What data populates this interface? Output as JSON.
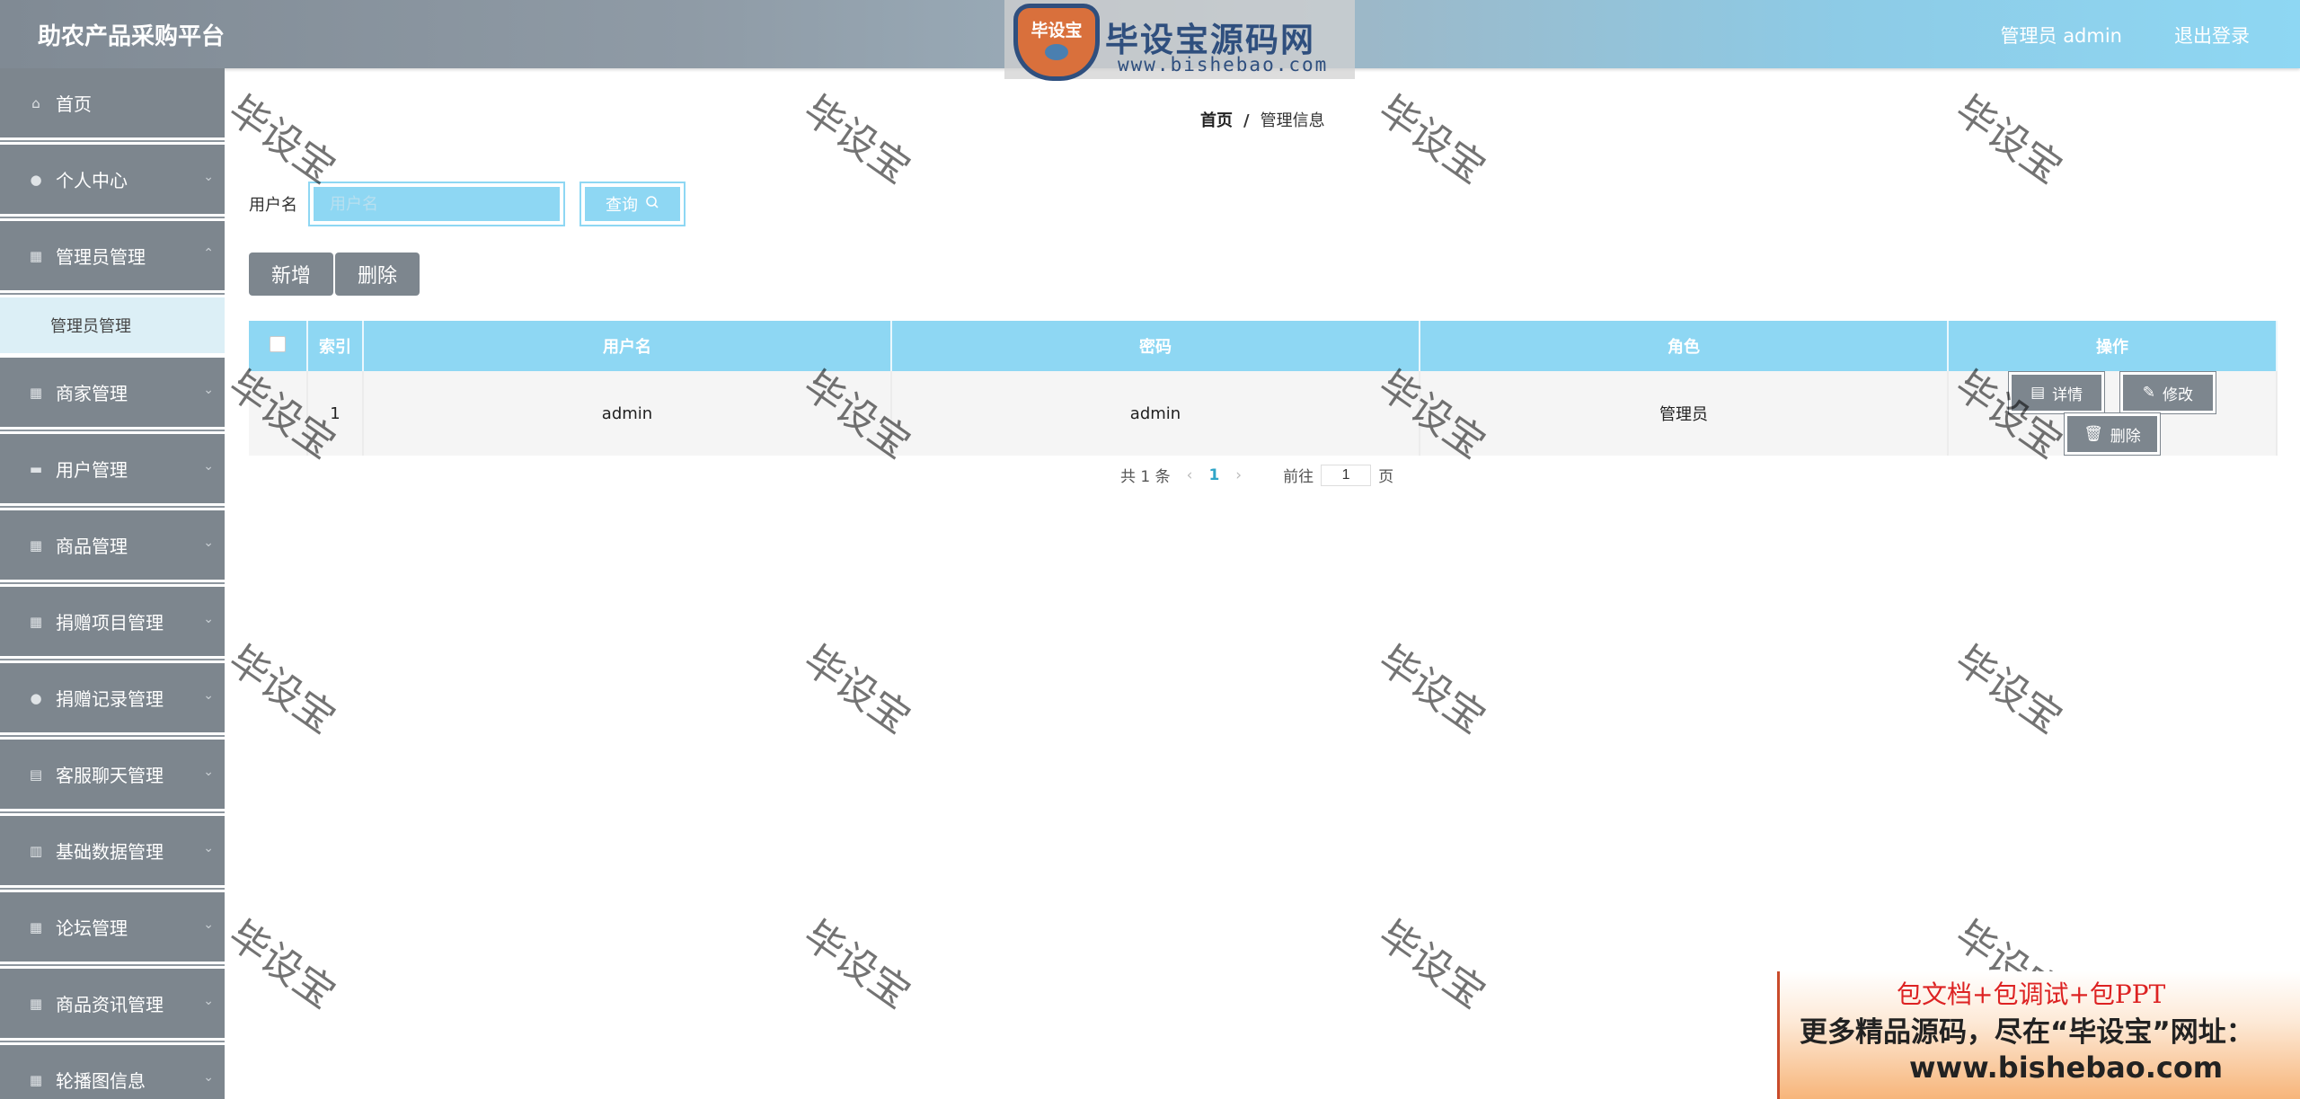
{
  "header": {
    "app_title": "助农产品采购平台",
    "user_label": "管理员 admin",
    "logout_label": "退出登录",
    "logo_badge": "毕设宝",
    "logo_name": "毕设宝源码网",
    "logo_url": "www.bishebao.com"
  },
  "sidebar": {
    "items": [
      {
        "label": "首页",
        "icon": "home-icon"
      },
      {
        "label": "个人中心",
        "icon": "user-icon"
      },
      {
        "label": "管理员管理",
        "icon": "grid-icon"
      },
      {
        "label": "商家管理",
        "icon": "grid-icon"
      },
      {
        "label": "用户管理",
        "icon": "ticket-icon"
      },
      {
        "label": "商品管理",
        "icon": "grid-icon"
      },
      {
        "label": "捐赠项目管理",
        "icon": "grid-icon"
      },
      {
        "label": "捐赠记录管理",
        "icon": "user-icon"
      },
      {
        "label": "客服聊天管理",
        "icon": "chat-icon"
      },
      {
        "label": "基础数据管理",
        "icon": "chart-icon"
      },
      {
        "label": "论坛管理",
        "icon": "grid-icon"
      },
      {
        "label": "商品资讯管理",
        "icon": "grid-icon"
      },
      {
        "label": "轮播图信息",
        "icon": "grid-icon"
      }
    ],
    "submenu": {
      "label": "管理员管理"
    }
  },
  "breadcrumb": {
    "home": "首页",
    "separator": "/",
    "current": "管理信息"
  },
  "search": {
    "label": "用户名",
    "placeholder": "用户名",
    "value": "",
    "button": "查询"
  },
  "actions": {
    "add": "新增",
    "delete": "删除"
  },
  "table": {
    "headers": [
      "",
      "索引",
      "用户名",
      "密码",
      "角色",
      "操作"
    ],
    "rows": [
      {
        "index": "1",
        "username": "admin",
        "password": "admin",
        "role": "管理员"
      }
    ],
    "ops": {
      "detail": "详情",
      "edit": "修改",
      "remove": "删除"
    }
  },
  "pagination": {
    "total_text": "共 1 条",
    "current_page": "1",
    "goto_prefix": "前往",
    "goto_value": "1",
    "goto_suffix": "页"
  },
  "watermark": "毕设宝",
  "promo": {
    "line1": "包文档+包调试+包PPT",
    "line2": "更多精品源码，尽在“毕设宝”网址：",
    "line3": "www.bishebao.com"
  },
  "colors": {
    "accent": "#8ed7f3",
    "sidebar": "#7d868e",
    "submenu_bg": "#dceff6"
  }
}
